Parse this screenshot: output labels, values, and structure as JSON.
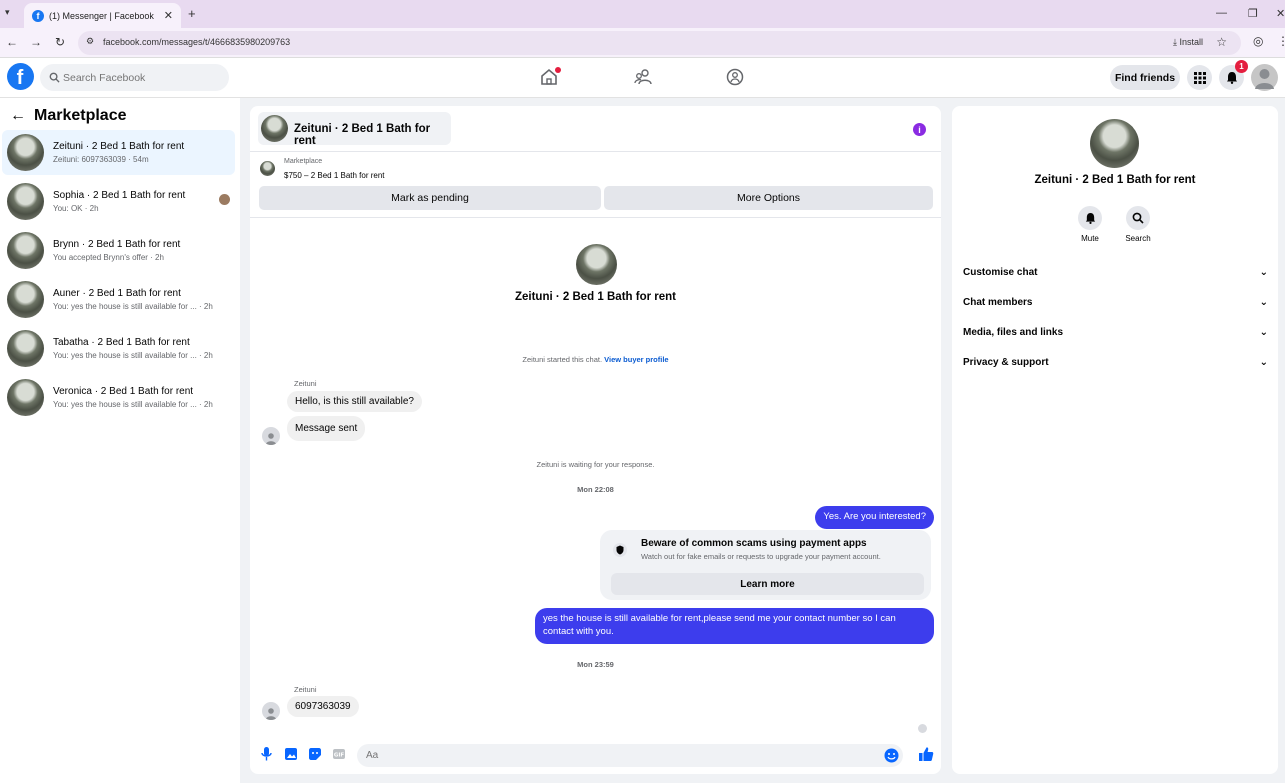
{
  "browser": {
    "tab_title": "(1) Messenger | Facebook",
    "url": "facebook.com/messages/t/4666835980209763",
    "install_label": "Install"
  },
  "topbar": {
    "search_placeholder": "Search Facebook",
    "find_friends_label": "Find friends",
    "notification_count": "1"
  },
  "sidebar": {
    "title": "Marketplace",
    "conversations": [
      {
        "name": "Zeituni · 2 Bed 1 Bath for rent",
        "preview": "Zeituni: 6097363039 · 54m"
      },
      {
        "name": "Sophia · 2 Bed 1 Bath for rent",
        "preview": "You: OK · 2h"
      },
      {
        "name": "Brynn · 2 Bed 1 Bath for rent",
        "preview": "You accepted Brynn's offer · 2h"
      },
      {
        "name": "Auner · 2 Bed 1 Bath for rent",
        "preview": "You: yes the house is still available for ... · 2h"
      },
      {
        "name": "Tabatha · 2 Bed 1 Bath for rent",
        "preview": "You: yes the house is still available for ... · 2h"
      },
      {
        "name": "Veronica · 2 Bed 1 Bath for rent",
        "preview": "You: yes the house is still available for ... · 2h"
      }
    ]
  },
  "chat": {
    "header_title": "Zeituni · 2 Bed 1 Bath for rent",
    "marketplace_label": "Marketplace",
    "listing": "$750 – 2 Bed 1 Bath for rent",
    "mark_pending_label": "Mark as pending",
    "more_options_label": "More Options",
    "intro_name": "Zeituni · 2 Bed 1 Bath for rent",
    "started_text": "Zeituni started this chat.",
    "view_profile_link": "View buyer profile",
    "sender_name_1": "Zeituni",
    "msg_in_1": "Hello, is this still available?",
    "msg_in_2": "Message sent",
    "waiting_text": "Zeituni is waiting for your response.",
    "time_1": "Mon 22:08",
    "msg_out_1": "Yes. Are you interested?",
    "scam_title": "Beware of common scams using payment apps",
    "scam_sub": "Watch out for fake emails or requests to upgrade your payment account.",
    "learn_more_label": "Learn more",
    "msg_out_2": "yes the house is still available for rent,please send me your contact number so I can contact with you.",
    "time_2": "Mon 23:59",
    "sender_name_2": "Zeituni",
    "msg_in_3": "6097363039",
    "composer_placeholder": "Aa"
  },
  "details": {
    "name": "Zeituni · 2 Bed 1 Bath for rent",
    "mute_label": "Mute",
    "search_label": "Search",
    "sections": [
      "Customise chat",
      "Chat members",
      "Media, files and links",
      "Privacy & support"
    ]
  },
  "colors": {
    "brand": "#1877f2",
    "outgoing_bubble": "#3d3ded",
    "notification_red": "#e41e3f"
  }
}
